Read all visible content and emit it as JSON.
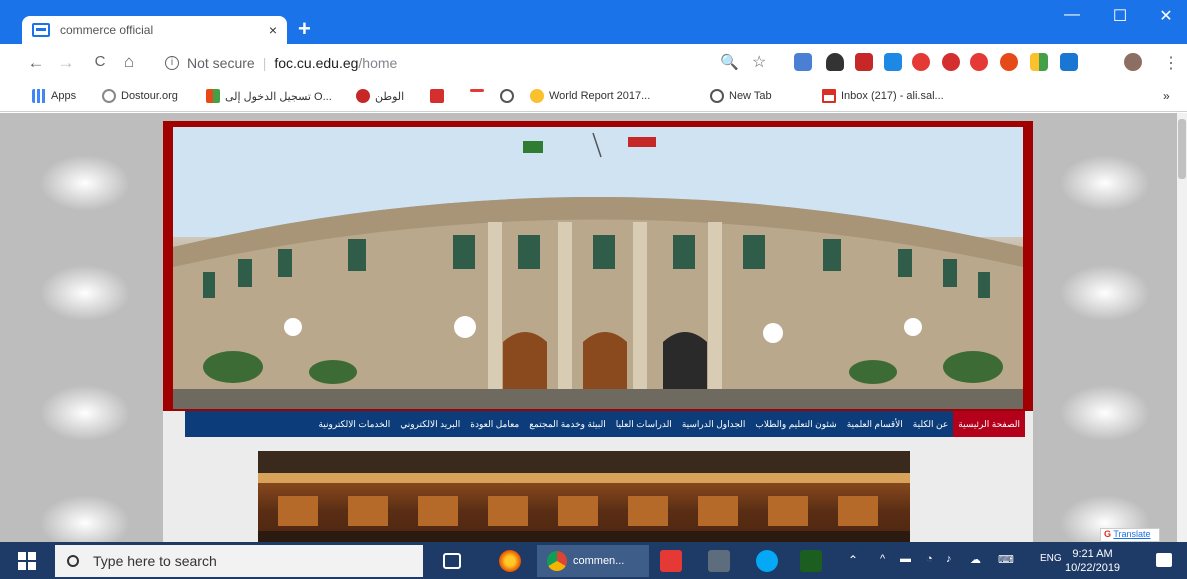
{
  "browser": {
    "tab_title": "commerce official",
    "tab_close": "×",
    "new_tab": "+",
    "window_controls": {
      "minimize": "—",
      "maximize": "☐",
      "close": "✕"
    },
    "toolbar": {
      "back": "←",
      "forward": "→",
      "reload": "C",
      "home": "⌂"
    },
    "address": {
      "info_icon": "i",
      "security_text": "Not secure",
      "separator": "|",
      "host": "foc.cu.edu.eg",
      "path": "/home"
    },
    "omnibox_icons": {
      "search": "🔍",
      "star": "☆"
    },
    "menu": "⋮",
    "bookmarks": [
      {
        "label": "Apps",
        "icon": "apps-icon",
        "color": "#4285f4"
      },
      {
        "label": "Dostour.org",
        "icon": "globe-icon",
        "color": "#888888"
      },
      {
        "label": "تسجيل الدخول إلى O...",
        "icon": "office-icon",
        "color": "#e64a19"
      },
      {
        "label": "الوطن",
        "icon": "elwatan-icon",
        "color": "#c62828"
      },
      {
        "label": "",
        "icon": "flag-icon",
        "color": "#d32f2f"
      },
      {
        "label": "",
        "icon": "dash-icon",
        "color": "#e53935"
      },
      {
        "label": "",
        "icon": "globe-icon",
        "color": "#555555"
      },
      {
        "label": "World Report 2017...",
        "icon": "check-icon",
        "color": "#fbc02d"
      },
      {
        "label": "New Tab",
        "icon": "globe-icon",
        "color": "#555555"
      },
      {
        "label": "Inbox (217) - ali.sal...",
        "icon": "gmail-icon",
        "color": "#d93025"
      }
    ],
    "bookmarks_more": "»"
  },
  "page": {
    "nav_items": [
      "الصفحة الرئيسية",
      "عن الكلية",
      "الأقسام العلمية",
      "شئون التعليم والطلاب",
      "الجداول الدراسية",
      "الدراسات العليا",
      "البيئة وخدمة المجتمع",
      "معامل العودة",
      "البريد الالكتروني",
      "الخدمات الالكترونية"
    ],
    "translate_label": "Translate"
  },
  "taskbar": {
    "search_placeholder": "Type here to search",
    "chrome_app_label": "commen...",
    "tray": {
      "expand": "^",
      "language": "ENG"
    },
    "clock": {
      "time": "9:21 AM",
      "date": "10/22/2019"
    }
  }
}
